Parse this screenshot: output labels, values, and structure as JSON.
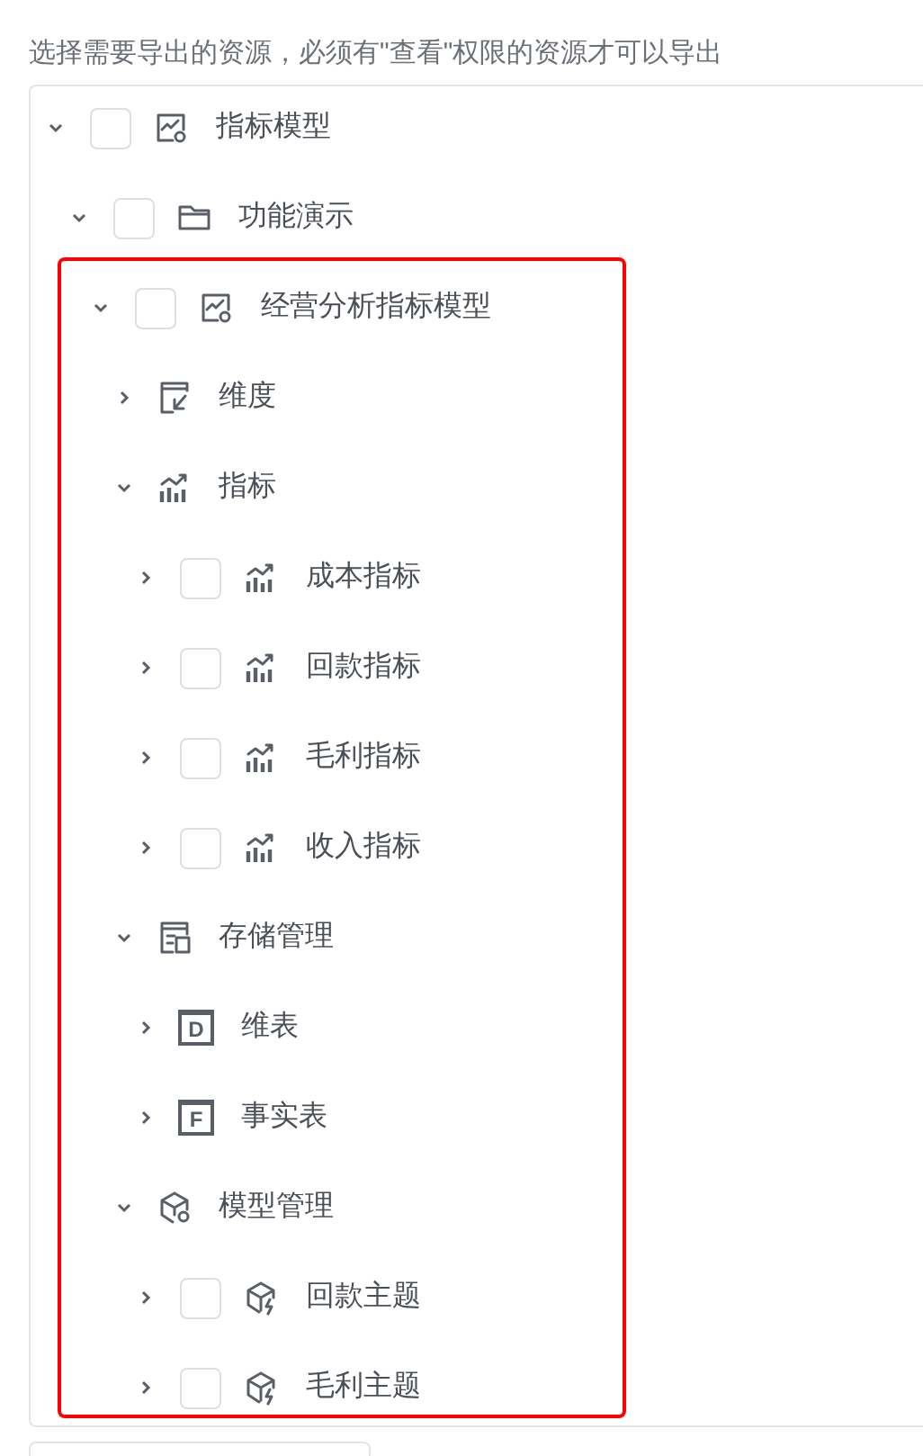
{
  "caption": "选择需要导出的资源，必须有\"查看\"权限的资源才可以导出",
  "tree": [
    {
      "label": "指标模型",
      "kind": "model",
      "checked": false,
      "expanded": true,
      "children": [
        {
          "label": "功能演示",
          "kind": "folder",
          "checked": false,
          "expanded": true,
          "children": [
            {
              "label": "经营分析指标模型",
              "kind": "model",
              "checked": false,
              "expanded": true,
              "children": [
                {
                  "label": "维度",
                  "kind": "dimension",
                  "expanded": false
                },
                {
                  "label": "指标",
                  "kind": "metric",
                  "expanded": true,
                  "children": [
                    {
                      "label": "成本指标",
                      "kind": "metric",
                      "checked": false,
                      "expanded": false
                    },
                    {
                      "label": "回款指标",
                      "kind": "metric",
                      "checked": false,
                      "expanded": false
                    },
                    {
                      "label": "毛利指标",
                      "kind": "metric",
                      "checked": false,
                      "expanded": false
                    },
                    {
                      "label": "收入指标",
                      "kind": "metric",
                      "checked": false,
                      "expanded": false
                    }
                  ]
                },
                {
                  "label": "存储管理",
                  "kind": "storage",
                  "expanded": true,
                  "children": [
                    {
                      "label": "维表",
                      "kind": "letter",
                      "icon_letter": "D",
                      "expanded": false
                    },
                    {
                      "label": "事实表",
                      "kind": "letter",
                      "icon_letter": "F",
                      "expanded": false
                    }
                  ]
                },
                {
                  "label": "模型管理",
                  "kind": "cube-gear",
                  "expanded": true,
                  "children": [
                    {
                      "label": "回款主题",
                      "kind": "cube-bolt",
                      "checked": false,
                      "expanded": false
                    },
                    {
                      "label": "毛利主题",
                      "kind": "cube-bolt",
                      "checked": false,
                      "expanded": false
                    }
                  ]
                }
              ]
            }
          ]
        }
      ]
    }
  ]
}
